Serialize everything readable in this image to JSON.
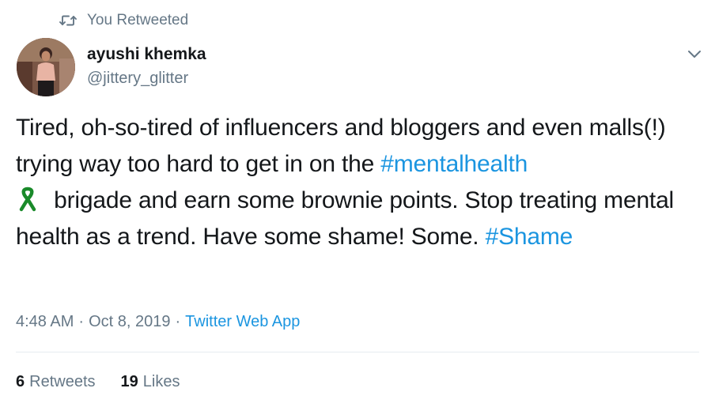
{
  "retweet_context": {
    "icon": "retweet-icon",
    "label": "You Retweeted"
  },
  "author": {
    "display_name": "ayushi khemka",
    "handle": "@jittery_glitter",
    "avatar_icon": "user-avatar"
  },
  "tweet": {
    "text_parts": {
      "p1": "Tired, oh-so-tired of influencers and bloggers and even malls(!) trying way too hard to get in on the ",
      "hashtag1": "#mentalhealth",
      "p2": " brigade and earn some brownie points. Stop treating mental health as a trend. Have some shame! Some. ",
      "hashtag2": "#Shame"
    },
    "emoji_icon": "green-ribbon-icon"
  },
  "meta": {
    "time": "4:48 AM",
    "separator": "·",
    "date": "Oct 8, 2019",
    "source": "Twitter Web App"
  },
  "stats": {
    "retweets_count": "6",
    "retweets_label": "Retweets",
    "likes_count": "19",
    "likes_label": "Likes"
  },
  "colors": {
    "link": "#1b95e0",
    "secondary": "#657786",
    "primary_text": "#14171a",
    "ribbon": "#1a8a2a"
  }
}
